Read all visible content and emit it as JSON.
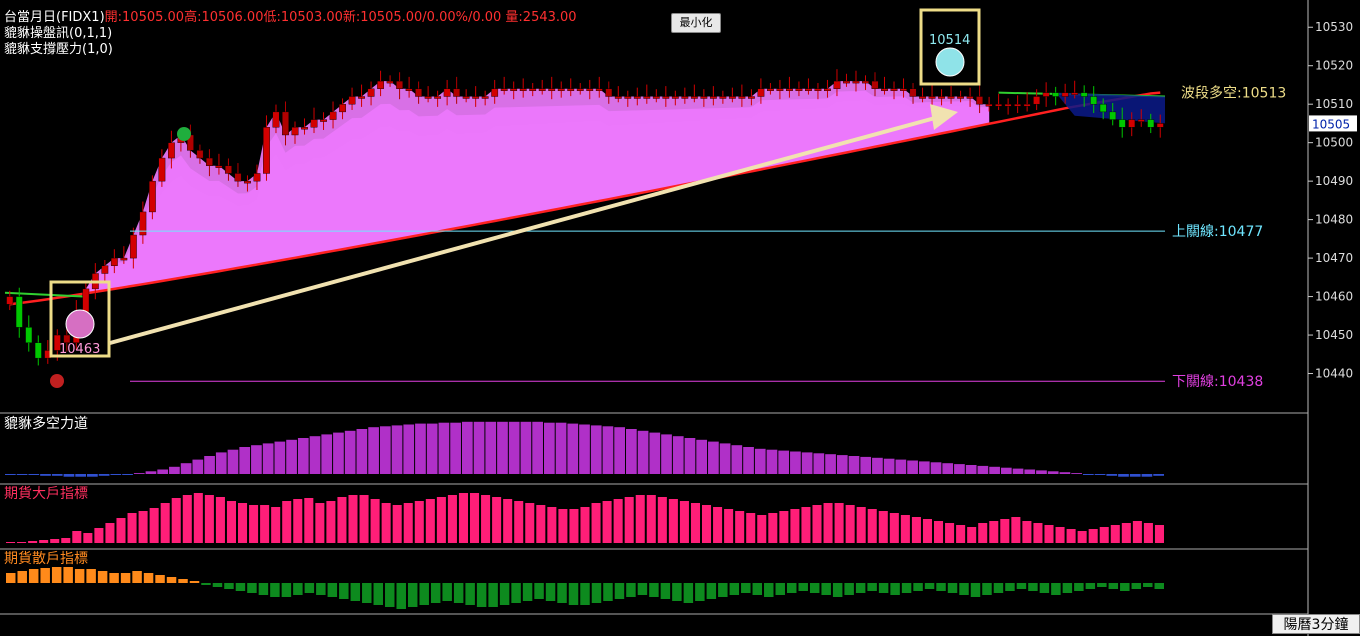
{
  "header": {
    "symbol": "台當月日(FIDX1)",
    "quote": "開:10505.00高:10506.00低:10503.00新:10505.00/0.00%/0.00 量:2543.00",
    "indicator1": "貔貅操盤訊(0,1,1)",
    "indicator2": "貔貅支撐壓力(1,0)"
  },
  "minimize_label": "最小化",
  "status_label": "陽曆3分鐘",
  "colors": {
    "up": "#d20000",
    "down": "#00c800",
    "ma": "#ff2020",
    "upper": "#6fe6ff",
    "lower": "#e040e0",
    "gold": "#eedd88"
  },
  "chart_data": {
    "type": "candlestick",
    "y_axis": {
      "min": 10430,
      "max": 10535,
      "ticks": [
        10440,
        10450,
        10460,
        10470,
        10480,
        10490,
        10500,
        10510,
        10520,
        10530
      ],
      "current_label": "10505"
    },
    "levels": [
      {
        "label": "波段多空:10513",
        "value": 10513
      },
      {
        "label": "上關線:10477",
        "value": 10477
      },
      {
        "label": "下關線:10438",
        "value": 10438
      }
    ],
    "markers": [
      {
        "label": "10463",
        "value": 10463
      },
      {
        "label": "10514",
        "value": 10514
      }
    ],
    "close": [
      10460,
      10452,
      10448,
      10444,
      10446,
      10450,
      10448,
      10456,
      10462,
      10466,
      10468,
      10470,
      10470,
      10476,
      10482,
      10490,
      10496,
      10500,
      10502,
      10498,
      10496,
      10494,
      10494,
      10492,
      10490,
      10490,
      10492,
      10504,
      10508,
      10502,
      10504,
      10504,
      10506,
      10506,
      10508,
      10510,
      10512,
      10512,
      10514,
      10516,
      10516,
      10514,
      10514,
      10512,
      10512,
      10512,
      10514,
      10512,
      10512,
      10512,
      10512,
      10514,
      10514,
      10514,
      10514,
      10514,
      10514,
      10514,
      10514,
      10514,
      10514,
      10514,
      10514,
      10512,
      10512,
      10512,
      10512,
      10512,
      10512,
      10512,
      10512,
      10512,
      10512,
      10512,
      10512,
      10512,
      10512,
      10512,
      10512,
      10514,
      10514,
      10514,
      10514,
      10514,
      10514,
      10514,
      10514,
      10516,
      10516,
      10516,
      10516,
      10514,
      10514,
      10514,
      10514,
      10512,
      10512,
      10512,
      10512,
      10512,
      10512,
      10512,
      10510,
      10510,
      10510,
      10510,
      10510,
      10510,
      10512,
      10513,
      10512,
      10513,
      10513,
      10512,
      10510,
      10508,
      10506,
      10504,
      10506,
      10506,
      10504,
      10505
    ],
    "sub_panels": [
      {
        "label": "貔貅多空力道",
        "values": [
          0,
          -1,
          -1,
          -2,
          -2,
          -3,
          -3,
          -3,
          -2,
          -1,
          0,
          1,
          3,
          5,
          8,
          12,
          16,
          20,
          24,
          27,
          30,
          32,
          34,
          36,
          38,
          40,
          42,
          44,
          46,
          48,
          50,
          52,
          53,
          54,
          55,
          56,
          56,
          57,
          57,
          58,
          58,
          58,
          58,
          58,
          58,
          58,
          57,
          57,
          56,
          55,
          54,
          53,
          52,
          50,
          48,
          46,
          44,
          42,
          40,
          38,
          36,
          34,
          32,
          30,
          28,
          27,
          26,
          25,
          24,
          23,
          22,
          21,
          20,
          19,
          18,
          17,
          16,
          15,
          14,
          13,
          12,
          11,
          10,
          9,
          8,
          7,
          6,
          5,
          4,
          3,
          2,
          1,
          0,
          -1,
          -2,
          -3,
          -3,
          -3,
          -2
        ]
      },
      {
        "label": "期貨大戶指標",
        "values": [
          1,
          1,
          2,
          3,
          4,
          5,
          12,
          10,
          15,
          20,
          25,
          30,
          32,
          35,
          40,
          45,
          48,
          50,
          48,
          46,
          42,
          40,
          38,
          38,
          36,
          42,
          44,
          45,
          40,
          42,
          46,
          48,
          48,
          44,
          40,
          38,
          40,
          42,
          44,
          46,
          48,
          50,
          50,
          48,
          46,
          44,
          42,
          40,
          38,
          36,
          34,
          34,
          36,
          40,
          42,
          44,
          46,
          48,
          48,
          46,
          44,
          42,
          40,
          38,
          36,
          34,
          32,
          30,
          28,
          30,
          32,
          34,
          36,
          38,
          40,
          40,
          38,
          36,
          34,
          32,
          30,
          28,
          26,
          24,
          22,
          20,
          18,
          16,
          20,
          22,
          24,
          26,
          22,
          20,
          18,
          16,
          14,
          12,
          14,
          16,
          18,
          20,
          22,
          20,
          18
        ]
      },
      {
        "label": "期貨散戶指標",
        "values": [
          10,
          12,
          14,
          15,
          16,
          16,
          14,
          14,
          12,
          10,
          10,
          12,
          10,
          8,
          6,
          4,
          2,
          -2,
          -4,
          -6,
          -8,
          -10,
          -12,
          -14,
          -14,
          -12,
          -10,
          -12,
          -14,
          -16,
          -18,
          -20,
          -22,
          -24,
          -26,
          -24,
          -22,
          -20,
          -18,
          -20,
          -22,
          -24,
          -24,
          -22,
          -20,
          -18,
          -16,
          -18,
          -20,
          -22,
          -22,
          -20,
          -18,
          -16,
          -14,
          -12,
          -14,
          -16,
          -18,
          -20,
          -18,
          -16,
          -14,
          -12,
          -10,
          -12,
          -14,
          -12,
          -10,
          -8,
          -10,
          -12,
          -14,
          -12,
          -10,
          -8,
          -10,
          -12,
          -10,
          -8,
          -6,
          -8,
          -10,
          -12,
          -14,
          -12,
          -10,
          -8,
          -6,
          -8,
          -10,
          -12,
          -10,
          -8,
          -6,
          -4,
          -6,
          -8,
          -6,
          -4,
          -6
        ]
      }
    ]
  }
}
